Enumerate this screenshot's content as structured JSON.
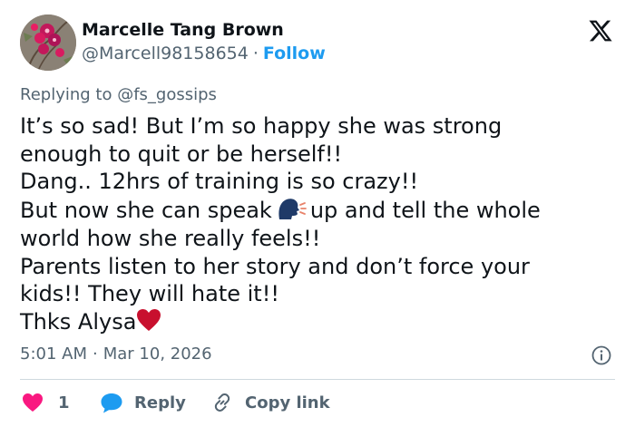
{
  "author": {
    "name": "Marcelle Tang Brown",
    "handle": "@Marcell98158654",
    "separator": "·",
    "follow_label": "Follow"
  },
  "logo": {
    "icon": "x-logo-icon"
  },
  "reply_context": {
    "prefix": "Replying to",
    "mention": "@fs_gossips"
  },
  "tweet": {
    "lines": [
      "It’s so sad!  But I’m so happy she was strong",
      "enough to quit or be herself!!",
      "Dang.. 12hrs of training is so crazy!!",
      "But now she can speak",
      "up and tell the whole",
      "world how she really feels!!",
      "Parents listen to her story and don’t force your",
      "kids!! They will hate it!!",
      "Thks Alysa"
    ],
    "emojis": [
      "speaking-head-emoji",
      "red-heart-emoji"
    ]
  },
  "meta": {
    "time": "5:01 AM",
    "separator": "·",
    "date": "Mar 10, 2026"
  },
  "actions": {
    "like_count": "1",
    "reply_label": "Reply",
    "copy_link_label": "Copy link"
  },
  "colors": {
    "text": "#0f1419",
    "muted": "#536471",
    "link": "#1d9bf0",
    "heart": "#f91880",
    "reply_bubble": "#1d9bf0",
    "divider": "#cfd9de"
  }
}
